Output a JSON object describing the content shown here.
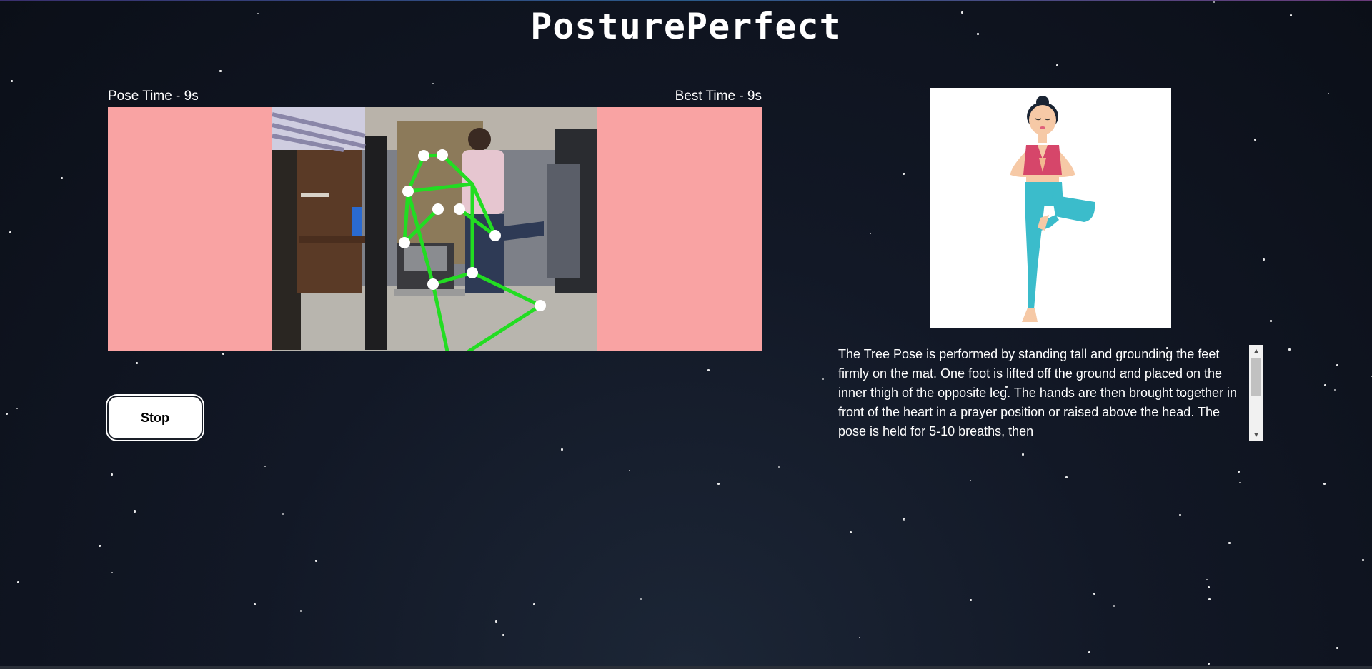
{
  "app": {
    "title": "PosturePerfect"
  },
  "timer": {
    "pose_time_label": "Pose Time - 9s",
    "best_time_label": "Best Time - 9s"
  },
  "controls": {
    "stop_label": "Stop"
  },
  "pose": {
    "name": "Tree Pose",
    "description": "The Tree Pose is performed by standing tall and grounding the feet firmly on the mat. One foot is lifted off the ground and placed on the inner thigh of the opposite leg. The hands are then brought together in front of the heart in a prayer position or raised above the head. The pose is held for 5-10 breaths, then"
  },
  "colors": {
    "background": "#121826",
    "camera_panel": "#f9a3a3",
    "skeleton_line": "#22dd22",
    "keypoint": "#ffffff",
    "button_bg": "#ffffff"
  },
  "scrollbar": {
    "position_fraction": 0.0
  }
}
